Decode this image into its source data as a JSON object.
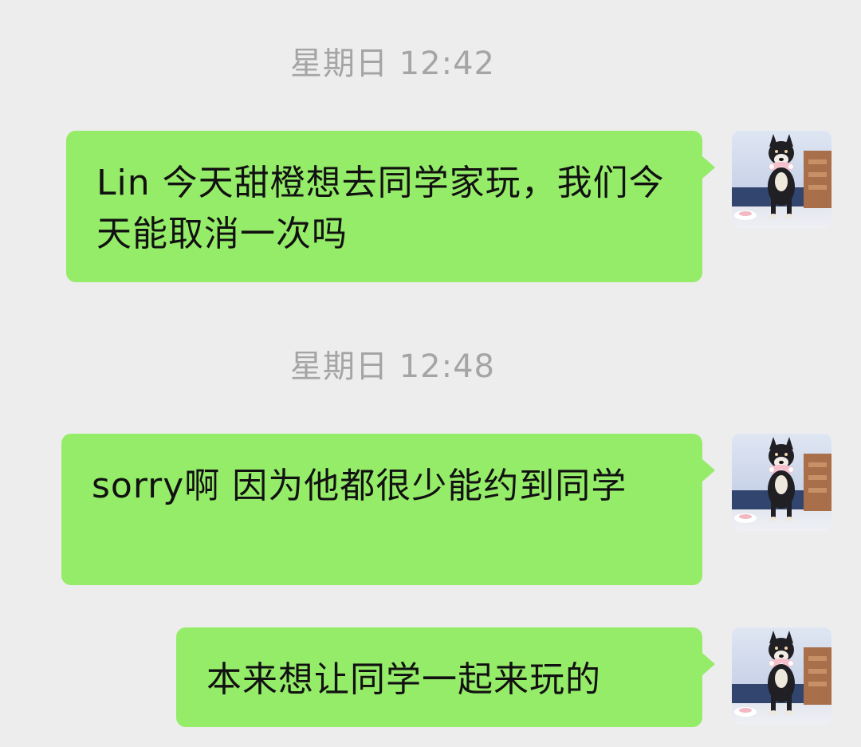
{
  "chat": {
    "messages": [
      {
        "timestamp": "星期日 12:42",
        "text": "Lin 今天甜橙想去同学家玩，我们今天能取消一次吗",
        "avatar": "shiba-dog-avatar"
      },
      {
        "timestamp": "星期日 12:48",
        "text": "sorry啊 因为他都很少能约到同学",
        "avatar": "shiba-dog-avatar"
      },
      {
        "text": "本来想让同学一起来玩的",
        "avatar": "shiba-dog-avatar"
      }
    ]
  },
  "colors": {
    "background": "#ededed",
    "bubble": "#95ec69",
    "timestamp": "#a5a5a5",
    "text": "#111111"
  }
}
